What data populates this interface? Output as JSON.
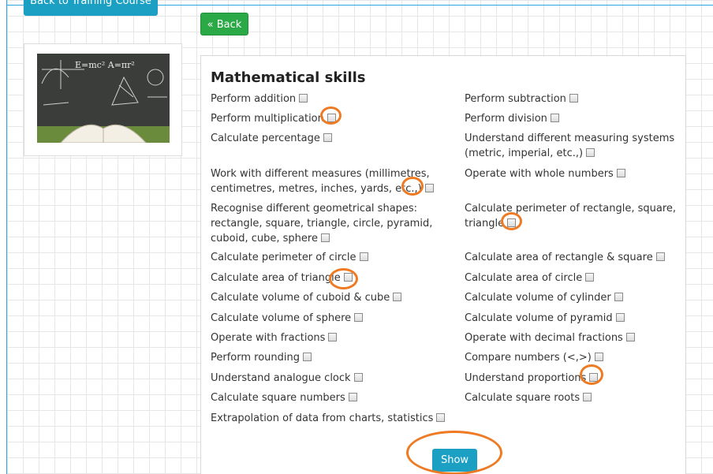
{
  "nav": {
    "course_button_label": "Back to Training Course",
    "back_button_label": "« Back"
  },
  "illustration": {
    "formula_text": "E=mc²  A=πr²"
  },
  "panel": {
    "title": "Mathematical skills",
    "show_button_label": "Show"
  },
  "skills": [
    {
      "label": "Perform addition",
      "checked": false
    },
    {
      "label": "Perform subtraction",
      "checked": false
    },
    {
      "label": "Perform multiplication",
      "checked": false
    },
    {
      "label": "Perform division",
      "checked": false
    },
    {
      "label": "Calculate percentage",
      "checked": false
    },
    {
      "label": "Understand different measuring systems (metric, imperial, etc.,)",
      "checked": false
    },
    {
      "label": "Work with different measures (millimetres, centimetres, metres, inches, yards, etc.,)",
      "checked": false
    },
    {
      "label": "Operate with whole numbers",
      "checked": false
    },
    {
      "label": "Recognise different geometrical shapes: rectangle, square, triangle, circle, pyramid, cuboid, cube, sphere",
      "checked": false
    },
    {
      "label": "Calculate perimeter of rectangle, square, triangle",
      "checked": false
    },
    {
      "label": "Calculate perimeter of circle",
      "checked": false
    },
    {
      "label": "Calculate area of rectangle & square",
      "checked": false
    },
    {
      "label": "Calculate area of triangle",
      "checked": false
    },
    {
      "label": "Calculate area of circle",
      "checked": false
    },
    {
      "label": "Calculate volume of cuboid & cube",
      "checked": false
    },
    {
      "label": "Calculate volume of cylinder",
      "checked": false
    },
    {
      "label": "Calculate volume of sphere",
      "checked": false
    },
    {
      "label": "Calculate volume of pyramid",
      "checked": false
    },
    {
      "label": "Operate with fractions",
      "checked": false
    },
    {
      "label": "Operate with decimal fractions",
      "checked": false
    },
    {
      "label": "Perform rounding",
      "checked": false
    },
    {
      "label": "Compare numbers (<,>)",
      "checked": false
    },
    {
      "label": "Understand analogue clock",
      "checked": false
    },
    {
      "label": "Understand proportions",
      "checked": false
    },
    {
      "label": "Calculate square numbers",
      "checked": false
    },
    {
      "label": "Calculate square roots",
      "checked": false
    },
    {
      "label": "Extrapolation of data from charts, statistics",
      "checked": false
    }
  ],
  "colors": {
    "accent_blue": "#1ba0c4",
    "back_green": "#2ca947",
    "annotation_orange": "#ee7a23"
  }
}
